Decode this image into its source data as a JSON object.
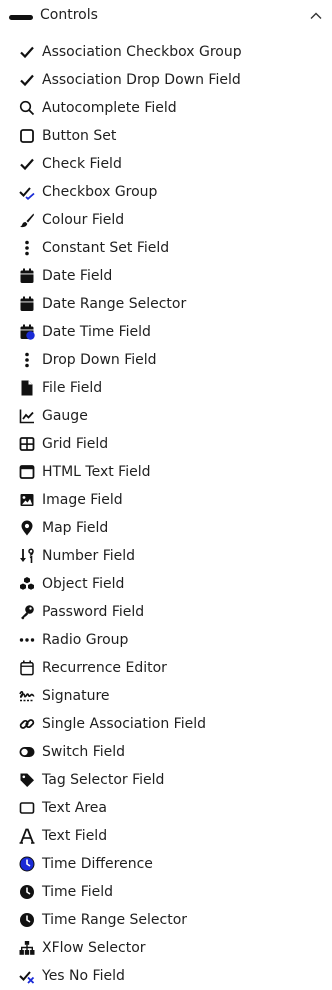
{
  "panel": {
    "title": "Controls",
    "collapse_icon": "chevron-up-icon",
    "header_icon": "dash-icon"
  },
  "colors": {
    "accent_blue": "#1a2bd6",
    "icon": "#111111",
    "text": "#1f1f1f"
  },
  "items": [
    {
      "label": "Association Checkbox Group",
      "icon": "check-icon"
    },
    {
      "label": "Association Drop Down Field",
      "icon": "check-icon"
    },
    {
      "label": "Autocomplete Field",
      "icon": "search-icon"
    },
    {
      "label": "Button Set",
      "icon": "square-outline-icon"
    },
    {
      "label": "Check Field",
      "icon": "check-icon"
    },
    {
      "label": "Checkbox Group",
      "icon": "double-check-icon"
    },
    {
      "label": "Colour Field",
      "icon": "paintbrush-icon"
    },
    {
      "label": "Constant Set Field",
      "icon": "vertical-dots-icon"
    },
    {
      "label": "Date Field",
      "icon": "calendar-icon"
    },
    {
      "label": "Date Range Selector",
      "icon": "calendar-icon"
    },
    {
      "label": "Date Time Field",
      "icon": "calendar-clock-icon"
    },
    {
      "label": "Drop Down Field",
      "icon": "vertical-dots-icon"
    },
    {
      "label": "File Field",
      "icon": "file-icon"
    },
    {
      "label": "Gauge",
      "icon": "line-chart-icon"
    },
    {
      "label": "Grid Field",
      "icon": "grid-table-icon"
    },
    {
      "label": "HTML Text Field",
      "icon": "window-icon"
    },
    {
      "label": "Image Field",
      "icon": "image-icon"
    },
    {
      "label": "Map Field",
      "icon": "map-pin-icon"
    },
    {
      "label": "Number Field",
      "icon": "sort-numeric-icon"
    },
    {
      "label": "Object Field",
      "icon": "cubes-icon"
    },
    {
      "label": "Password Field",
      "icon": "key-icon"
    },
    {
      "label": "Radio Group",
      "icon": "horizontal-dots-icon"
    },
    {
      "label": "Recurrence Editor",
      "icon": "calendar-outline-icon"
    },
    {
      "label": "Signature",
      "icon": "signature-icon"
    },
    {
      "label": "Single Association Field",
      "icon": "link-icon"
    },
    {
      "label": "Switch Field",
      "icon": "toggle-icon"
    },
    {
      "label": "Tag Selector Field",
      "icon": "tag-icon"
    },
    {
      "label": "Text Area",
      "icon": "rectangle-outline-icon"
    },
    {
      "label": "Text Field",
      "icon": "font-a-icon"
    },
    {
      "label": "Time Difference",
      "icon": "clock-blue-icon"
    },
    {
      "label": "Time Field",
      "icon": "clock-icon"
    },
    {
      "label": "Time Range Selector",
      "icon": "clock-icon"
    },
    {
      "label": "XFlow Selector",
      "icon": "sitemap-icon"
    },
    {
      "label": "Yes No Field",
      "icon": "check-cross-icon"
    }
  ]
}
